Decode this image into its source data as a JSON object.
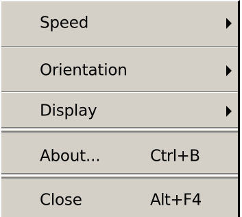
{
  "menu": {
    "items": [
      {
        "label": "Speed",
        "shortcut": "",
        "submenu": true
      },
      {
        "label": "Orientation",
        "shortcut": "",
        "submenu": true
      },
      {
        "label": "Display",
        "shortcut": "",
        "submenu": true
      },
      {
        "label": "About...",
        "shortcut": "Ctrl+B",
        "submenu": false
      },
      {
        "label": "Close",
        "shortcut": "Alt+F4",
        "submenu": false
      }
    ]
  },
  "icons": {
    "submenu_arrow": "triangle-right-icon"
  },
  "colors": {
    "menu_background": "#d4d0c8",
    "separator_dark": "#808080",
    "separator_light": "#ffffff",
    "text": "#000000"
  }
}
